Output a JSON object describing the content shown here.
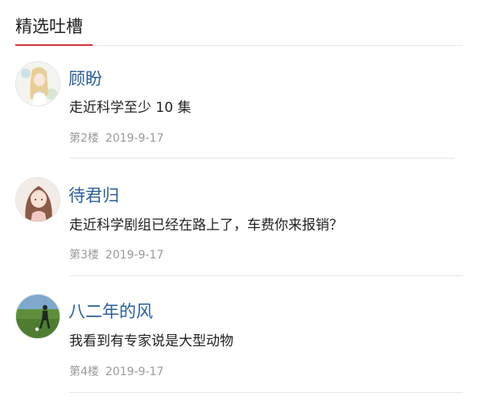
{
  "section": {
    "title": "精选吐槽",
    "accent_color": "#d0353a"
  },
  "comments": [
    {
      "avatar_icon": "anime-girl-avatar-icon",
      "username": "顾盼",
      "content": "走近科学至少 10 集",
      "floor": "第2楼",
      "date": "2019-9-17"
    },
    {
      "avatar_icon": "anime-girl-avatar-icon",
      "username": "待君归",
      "content": "走近科学剧组已经在路上了，车费你来报销？",
      "floor": "第3楼",
      "date": "2019-9-17"
    },
    {
      "avatar_icon": "soccer-field-avatar-icon",
      "username": "八二年的风",
      "content": "我看到有专家说是大型动物",
      "floor": "第4楼",
      "date": "2019-9-17"
    }
  ],
  "colors": {
    "username": "#2a5e9a",
    "content": "#222222",
    "meta": "#9a9a9a",
    "divider": "#e6e6e6"
  }
}
